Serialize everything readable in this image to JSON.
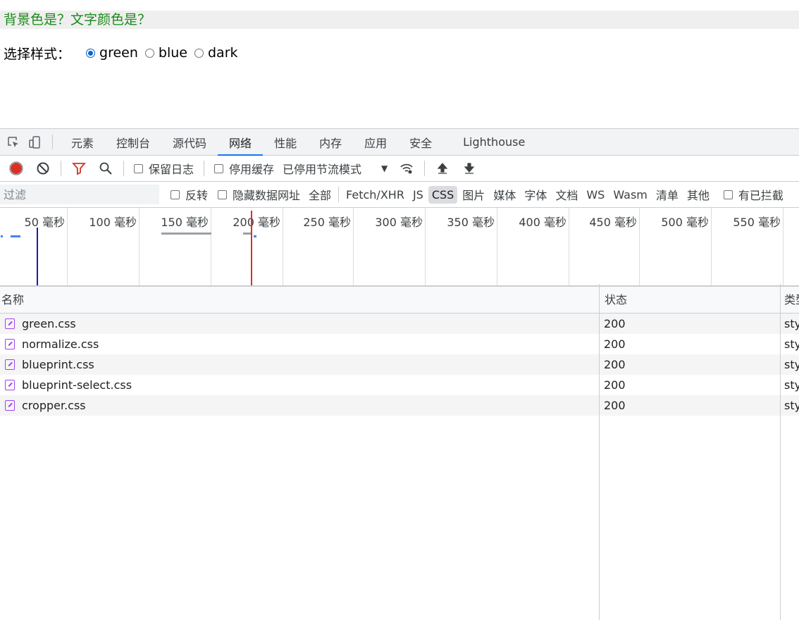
{
  "page": {
    "title": "背景色是？文字颜色是？",
    "style_label": "选择样式：",
    "style_options": [
      {
        "label": "green",
        "checked": true
      },
      {
        "label": "blue",
        "checked": false
      },
      {
        "label": "dark",
        "checked": false
      }
    ]
  },
  "devtools": {
    "tabs": [
      "元素",
      "控制台",
      "源代码",
      "网络",
      "性能",
      "内存",
      "应用",
      "安全",
      "Lighthouse"
    ],
    "active_tab": "网络",
    "toolbar": {
      "preserve_log": "保留日志",
      "disable_cache": "停用缓存",
      "throttling": "已停用节流模式"
    },
    "filter": {
      "placeholder": "过滤",
      "invert": "反转",
      "hide_data_urls": "隐藏数据网址",
      "types": [
        "全部",
        "Fetch/XHR",
        "JS",
        "CSS",
        "图片",
        "媒体",
        "字体",
        "文档",
        "WS",
        "Wasm",
        "清单",
        "其他"
      ],
      "active_type": "CSS",
      "blocked": "有已拦截"
    },
    "timeline_ticks": [
      "50 毫秒",
      "100 毫秒",
      "150 毫秒",
      "200 毫秒",
      "250 毫秒",
      "300 毫秒",
      "350 毫秒",
      "400 毫秒",
      "450 毫秒",
      "500 毫秒",
      "550 毫秒"
    ],
    "table": {
      "columns": [
        "名称",
        "状态",
        "类型"
      ],
      "rows": [
        {
          "name": "green.css",
          "status": "200",
          "type": "stylesheet"
        },
        {
          "name": "normalize.css",
          "status": "200",
          "type": "stylesheet"
        },
        {
          "name": "blueprint.css",
          "status": "200",
          "type": "stylesheet"
        },
        {
          "name": "blueprint-select.css",
          "status": "200",
          "type": "stylesheet"
        },
        {
          "name": "cropper.css",
          "status": "200",
          "type": "stylesheet"
        }
      ]
    },
    "colors": {
      "accent": "#1a73e8",
      "record": "#d93025",
      "page_text": "#1a8a1a",
      "file_icon": "#a142f4"
    }
  }
}
